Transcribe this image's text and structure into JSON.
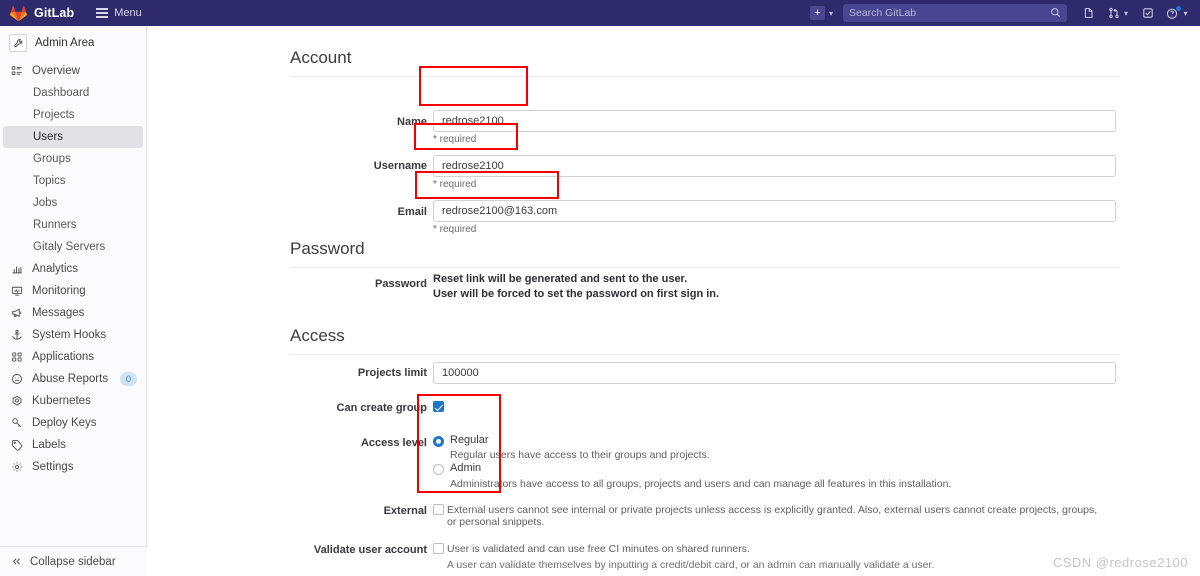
{
  "topbar": {
    "brand": "GitLab",
    "brand_logo_icon": "gitlab-tanuki-logo",
    "menu_label": "Menu",
    "new_button_icon": "plus-square-icon",
    "new_button_chevron_icon": "chevron-down-icon",
    "search_placeholder": "Search GitLab",
    "search_icon": "search-icon",
    "issues_icon": "issues-icon",
    "merge_requests_icon": "merge-request-icon",
    "merge_requests_chevron_icon": "chevron-down-icon",
    "todos_icon": "todo-checkbox-icon",
    "help_icon": "help-question-icon",
    "help_chevron_icon": "chevron-down-icon",
    "navbar_color": "#2f2a6b",
    "search_bg_color": "#4a4590"
  },
  "sidebar": {
    "context_title": "Admin Area",
    "context_icon": "wrench-icon",
    "collapse_label": "Collapse sidebar",
    "collapse_icon": "chevron-double-left-icon",
    "items": [
      {
        "label": "Overview",
        "icon": "overview-list-icon",
        "type": "top"
      },
      {
        "label": "Dashboard",
        "type": "sub",
        "active": false
      },
      {
        "label": "Projects",
        "type": "sub",
        "active": false
      },
      {
        "label": "Users",
        "type": "sub",
        "active": true
      },
      {
        "label": "Groups",
        "type": "sub",
        "active": false
      },
      {
        "label": "Topics",
        "type": "sub",
        "active": false
      },
      {
        "label": "Jobs",
        "type": "sub",
        "active": false
      },
      {
        "label": "Runners",
        "type": "sub",
        "active": false
      },
      {
        "label": "Gitaly Servers",
        "type": "sub",
        "active": false
      },
      {
        "label": "Analytics",
        "icon": "chart-bar-icon",
        "type": "top"
      },
      {
        "label": "Monitoring",
        "icon": "monitor-icon",
        "type": "top"
      },
      {
        "label": "Messages",
        "icon": "megaphone-icon",
        "type": "top"
      },
      {
        "label": "System Hooks",
        "icon": "anchor-icon",
        "type": "top"
      },
      {
        "label": "Applications",
        "icon": "applications-grid-icon",
        "type": "top"
      },
      {
        "label": "Abuse Reports",
        "icon": "abuse-face-icon",
        "type": "top",
        "badge": "0"
      },
      {
        "label": "Kubernetes",
        "icon": "kubernetes-icon",
        "type": "top"
      },
      {
        "label": "Deploy Keys",
        "icon": "key-icon",
        "type": "top"
      },
      {
        "label": "Labels",
        "icon": "label-tag-icon",
        "type": "top"
      },
      {
        "label": "Settings",
        "icon": "gear-icon",
        "type": "top"
      }
    ]
  },
  "account": {
    "heading": "Account",
    "name_label": "Name",
    "name_value": "redrose2100",
    "name_help": "* required",
    "username_label": "Username",
    "username_value": "redrose2100",
    "username_help": "* required",
    "email_label": "Email",
    "email_value": "redrose2100@163.com",
    "email_help": "* required"
  },
  "password": {
    "heading": "Password",
    "label": "Password",
    "line1": "Reset link will be generated and sent to the user.",
    "line2": "User will be forced to set the password on first sign in."
  },
  "access": {
    "heading": "Access",
    "projects_limit_label": "Projects limit",
    "projects_limit_value": "100000",
    "can_create_group_label": "Can create group",
    "can_create_group_checked": true,
    "access_level_label": "Access level",
    "options": [
      {
        "label": "Regular",
        "selected": true,
        "description": "Regular users have access to their groups and projects."
      },
      {
        "label": "Admin",
        "selected": false,
        "description": "Administrators have access to all groups, projects and users and can manage all features in this installation."
      }
    ],
    "external_label": "External",
    "external_checked": false,
    "external_description": "External users cannot see internal or private projects unless access is explicitly granted. Also, external users cannot create projects, groups, or personal snippets.",
    "validate_label": "Validate user account",
    "validate_checked": false,
    "validate_description": "User is validated and can use free CI minutes on shared runners.",
    "validate_subdescription": "A user can validate themselves by inputting a credit/debit card, or an admin can manually validate a user."
  },
  "watermark": "CSDN @redrose2100",
  "annotations": {
    "color": "#f40000",
    "boxes": [
      "name-field-highlight",
      "username-field-highlight",
      "email-field-highlight",
      "access-options-highlight"
    ]
  }
}
